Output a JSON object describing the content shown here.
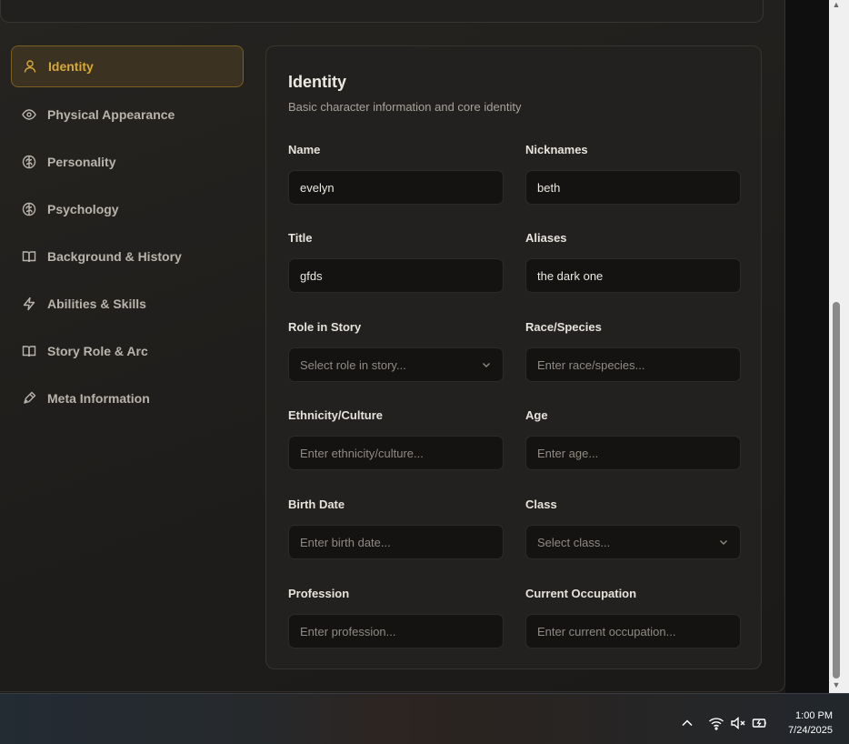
{
  "sidebar": {
    "items": [
      {
        "label": "Identity",
        "icon": "user-icon",
        "active": true
      },
      {
        "label": "Physical Appearance",
        "icon": "eye-icon"
      },
      {
        "label": "Personality",
        "icon": "brain-icon"
      },
      {
        "label": "Psychology",
        "icon": "brain-icon"
      },
      {
        "label": "Background & History",
        "icon": "book-icon"
      },
      {
        "label": "Abilities & Skills",
        "icon": "lightning-icon"
      },
      {
        "label": "Story Role & Arc",
        "icon": "book-icon"
      },
      {
        "label": "Meta Information",
        "icon": "pen-icon"
      }
    ]
  },
  "panel": {
    "title": "Identity",
    "subtitle": "Basic character information and core identity"
  },
  "fields": {
    "name": {
      "label": "Name",
      "value": "evelyn"
    },
    "nicknames": {
      "label": "Nicknames",
      "value": "beth"
    },
    "title": {
      "label": "Title",
      "value": "gfds"
    },
    "aliases": {
      "label": "Aliases",
      "value": "the dark one"
    },
    "role": {
      "label": "Role in Story",
      "placeholder": "Select role in story..."
    },
    "race": {
      "label": "Race/Species",
      "placeholder": "Enter race/species..."
    },
    "ethnicity": {
      "label": "Ethnicity/Culture",
      "placeholder": "Enter ethnicity/culture..."
    },
    "age": {
      "label": "Age",
      "placeholder": "Enter age..."
    },
    "birth_date": {
      "label": "Birth Date",
      "placeholder": "Enter birth date..."
    },
    "class": {
      "label": "Class",
      "placeholder": "Select class..."
    },
    "profession": {
      "label": "Profession",
      "placeholder": "Enter profession..."
    },
    "occupation": {
      "label": "Current Occupation",
      "placeholder": "Enter current occupation..."
    }
  },
  "taskbar": {
    "time": "1:00 PM",
    "date": "7/24/2025"
  },
  "colors": {
    "accent": "#d7a83a",
    "background": "#1f1d1b",
    "input_bg": "#141312"
  }
}
